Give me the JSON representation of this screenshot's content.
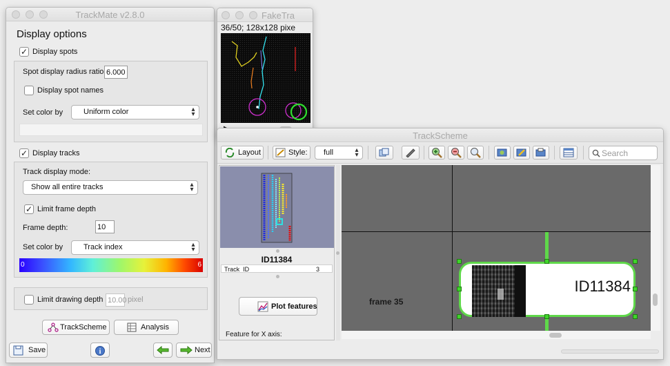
{
  "trackmate": {
    "title": "TrackMate v2.8.0",
    "heading": "Display options",
    "display_spots": {
      "label": "Display spots",
      "checked": true
    },
    "spot_radius": {
      "label": "Spot display radius ratio:",
      "value": "6.000"
    },
    "spot_names": {
      "label": "Display spot names",
      "checked": false
    },
    "spot_color": {
      "label": "Set color by",
      "value": "Uniform color"
    },
    "display_tracks": {
      "label": "Display tracks",
      "checked": true
    },
    "track_mode": {
      "label": "Track display mode:",
      "value": "Show all entire tracks"
    },
    "limit_frame_depth": {
      "label": "Limit frame depth",
      "checked": true
    },
    "frame_depth": {
      "label": "Frame depth:",
      "value": "10"
    },
    "track_color": {
      "label": "Set color by",
      "value": "Track index"
    },
    "colorbar": {
      "min": "0",
      "max": "6"
    },
    "limit_drawing_depth": {
      "label": "Limit drawing depth",
      "checked": false,
      "value": "10.00",
      "unit": "pixel"
    },
    "trackscheme_button": "TrackScheme",
    "analysis_button": "Analysis",
    "save_button": "Save",
    "next_button": "Next"
  },
  "faketracks": {
    "title": "FakeTra",
    "info": "36/50; 128x128 pixe"
  },
  "trackscheme": {
    "title": "TrackScheme",
    "toolbar": {
      "layout_label": "Layout",
      "style_label": "Style:",
      "style_value": "full",
      "search_placeholder": "Search"
    },
    "side": {
      "spot_title": "ID11384",
      "table_header": "Track_ID",
      "table_value": "3",
      "plot_button": "Plot features",
      "feature_x_label": "Feature for X axis:"
    },
    "graph": {
      "frame_label": "frame 35",
      "spot_label": "ID11384"
    }
  },
  "colors": {
    "selection_green": "#3fd52a",
    "graph_bg": "#6a6a6a",
    "overview_bg": "#8a8eac"
  },
  "icons": [
    "info-icon",
    "save-icon",
    "back-arrow-icon",
    "next-arrow-icon",
    "trackscheme-icon",
    "analysis-icon",
    "layout-icon",
    "style-icon",
    "zoom-in-icon",
    "zoom-out-icon",
    "search-icon",
    "play-icon",
    "plot-icon"
  ]
}
